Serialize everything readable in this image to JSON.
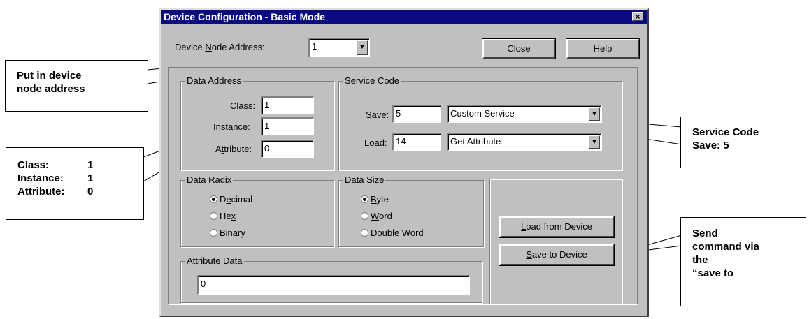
{
  "window": {
    "title": "Device Configuration - Basic Mode",
    "close_glyph": "×"
  },
  "device": {
    "node_address_label": "Device Node Address:",
    "node_address_value": "1",
    "close_button": "Close",
    "help_button": "Help"
  },
  "data_address": {
    "title": "Data Address",
    "class_label": "Class:",
    "class_value": "1",
    "instance_label": "Instance:",
    "instance_value": "1",
    "attribute_label": "Attribute:",
    "attribute_value": "0"
  },
  "service_code": {
    "title": "Service Code",
    "save_label": "Save:",
    "save_value": "5",
    "save_service": "Custom Service",
    "load_label": "Load:",
    "load_value": "14",
    "load_service": "Get Attribute"
  },
  "data_radix": {
    "title": "Data Radix",
    "options": [
      "Decimal",
      "Hex",
      "Binary"
    ],
    "selected": "Decimal"
  },
  "data_size": {
    "title": "Data Size",
    "options": [
      "Byte",
      "Word",
      "Double Word"
    ],
    "selected": "Byte"
  },
  "attribute_data": {
    "title": "Attribute Data",
    "value": "0"
  },
  "actions": {
    "load_button": "Load from Device",
    "save_button": "Save to Device"
  },
  "callouts": {
    "node_address": [
      "Put in device",
      "node address"
    ],
    "class_instance": {
      "labels": [
        "Class:",
        "Instance:",
        "Attribute:"
      ],
      "values": [
        "1",
        "1",
        "0"
      ]
    },
    "service_code": [
      "Service Code",
      "Save: 5"
    ],
    "send_command": [
      "Send",
      "command via",
      "the",
      "“save to"
    ]
  },
  "colors": {
    "titlebar": "#0a0a80",
    "dialog_face": "#c0c0c0",
    "field_background": "#ffffff"
  }
}
